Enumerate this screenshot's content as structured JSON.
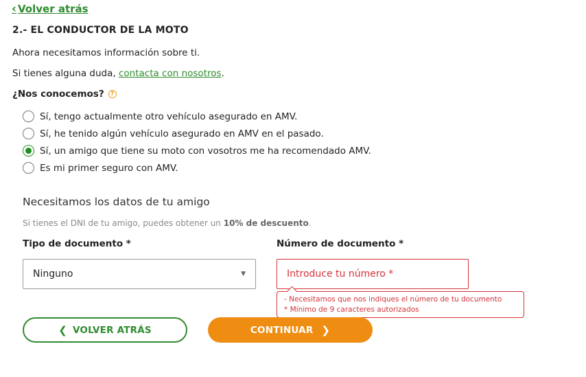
{
  "nav": {
    "back_label": "Volver atrás"
  },
  "section": {
    "title": "2.- EL CONDUCTOR DE LA MOTO"
  },
  "intro": {
    "line1": "Ahora necesitamos información sobre ti.",
    "line2_prefix": "Si tienes alguna duda, ",
    "line2_link": "contacta con nosotros",
    "line2_suffix": "."
  },
  "question": {
    "label": "¿Nos conocemos?",
    "help_icon": "question-circle-icon"
  },
  "radios": [
    {
      "label": "Sí, tengo actualmente otro vehículo asegurado en AMV.",
      "checked": false
    },
    {
      "label": "Sí, he tenido algún vehículo asegurado en AMV en el pasado.",
      "checked": false
    },
    {
      "label": "Sí, un amigo que tiene su moto con vosotros me ha recomendado AMV.",
      "checked": true
    },
    {
      "label": "Es mi primer seguro con AMV.",
      "checked": false
    }
  ],
  "friend": {
    "title": "Necesitamos los datos de tu amigo",
    "hint_prefix": "Si tienes el DNI de tu amigo, puedes obtener un ",
    "hint_bold": "10% de descuento",
    "hint_suffix": "."
  },
  "form": {
    "doc_type_label": "Tipo de documento *",
    "doc_type_value": "Ninguno",
    "doc_number_label": "Número de documento *",
    "doc_number_value": "",
    "doc_number_placeholder": "Introduce tu número *",
    "errors": [
      "- Necesitamos que nos indiques el número de tu documento",
      "* Mínimo de 9 caracteres autorizados"
    ]
  },
  "buttons": {
    "back": "VOLVER ATRÁS",
    "continue": "CONTINUAR"
  },
  "colors": {
    "green": "#2e8b2e",
    "orange": "#ee8d12",
    "error": "#d4323a"
  }
}
